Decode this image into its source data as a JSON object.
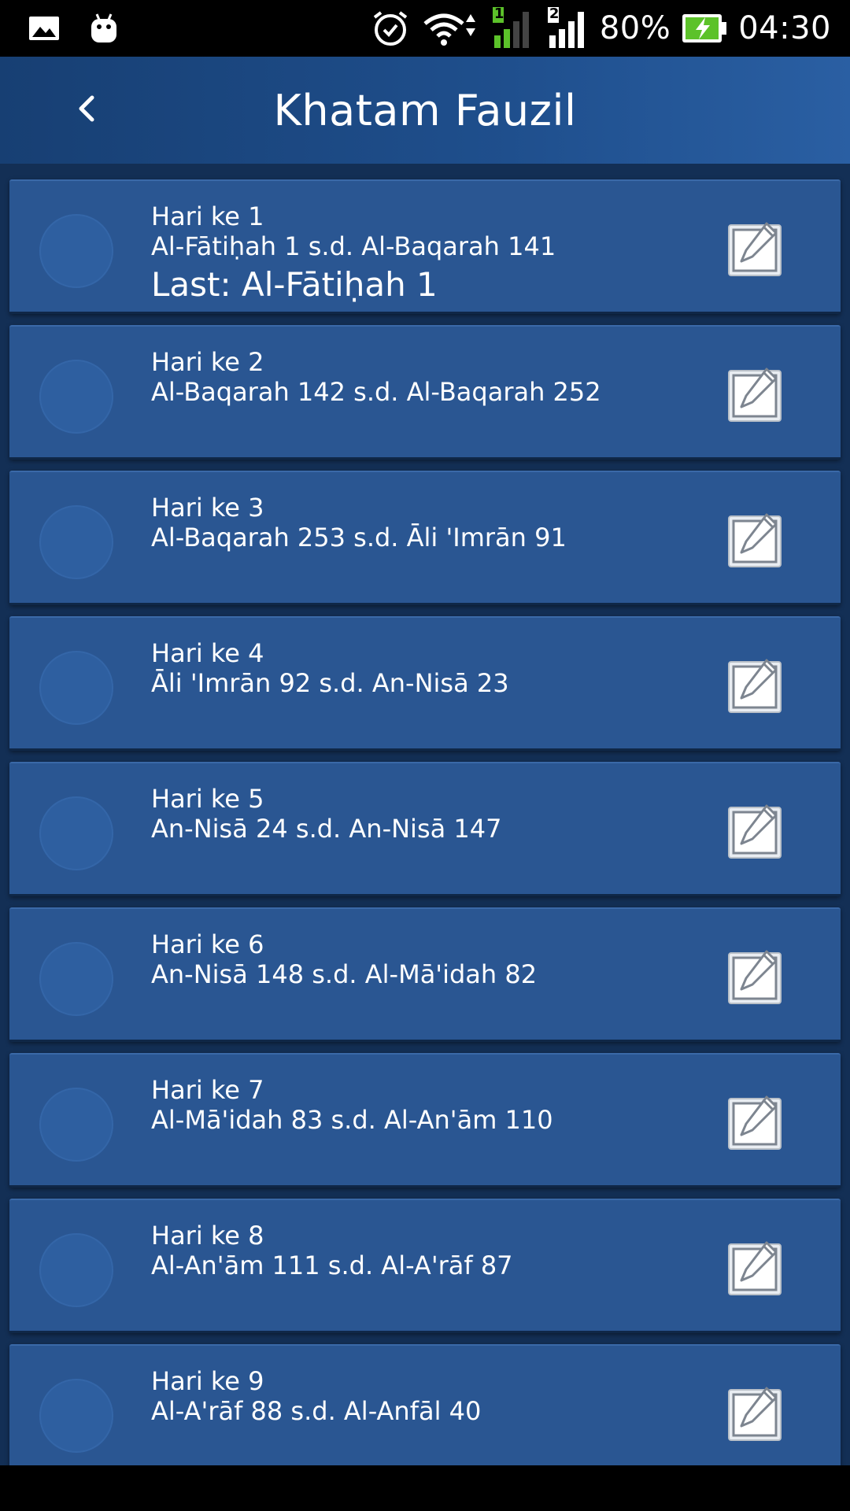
{
  "status_bar": {
    "left_icons": [
      "image-notification-icon",
      "android-debug-icon"
    ],
    "right_icons": [
      "alarm-icon",
      "wifi-icon",
      "signal-sim1-icon",
      "signal-sim2-icon",
      "battery-charging-icon"
    ],
    "sim1_label": "1",
    "sim2_label": "2",
    "battery": "80%",
    "time": "04:30"
  },
  "app_bar": {
    "back_icon": "chevron-left-icon",
    "title": "Khatam Fauzil"
  },
  "items": [
    {
      "day": "Hari ke 1",
      "range": "Al-Fātiḥah 1 s.d. Al-Baqarah 141",
      "last": "Last: Al-Fātiḥah 1"
    },
    {
      "day": "Hari ke 2",
      "range": "Al-Baqarah 142 s.d. Al-Baqarah 252"
    },
    {
      "day": "Hari ke 3",
      "range": "Al-Baqarah 253 s.d. Āli 'Imrān 91"
    },
    {
      "day": "Hari ke 4",
      "range": "Āli 'Imrān 92 s.d. An-Nisā 23"
    },
    {
      "day": "Hari ke 5",
      "range": "An-Nisā 24 s.d. An-Nisā 147"
    },
    {
      "day": "Hari ke 6",
      "range": "An-Nisā 148 s.d. Al-Mā'idah 82"
    },
    {
      "day": "Hari ke 7",
      "range": "Al-Mā'idah 83 s.d. Al-An'ām 110"
    },
    {
      "day": "Hari ke 8",
      "range": "Al-An'ām 111 s.d. Al-A'rāf 87"
    },
    {
      "day": "Hari ke 9",
      "range": "Al-A'rāf 88 s.d. Al-Anfāl 40"
    }
  ],
  "colors": {
    "app_bar": "#1f4f8d",
    "card": "#2a5692",
    "list_background": "#132f55",
    "battery_green": "#5cc22a",
    "sim1_green": "#5cc22a"
  }
}
